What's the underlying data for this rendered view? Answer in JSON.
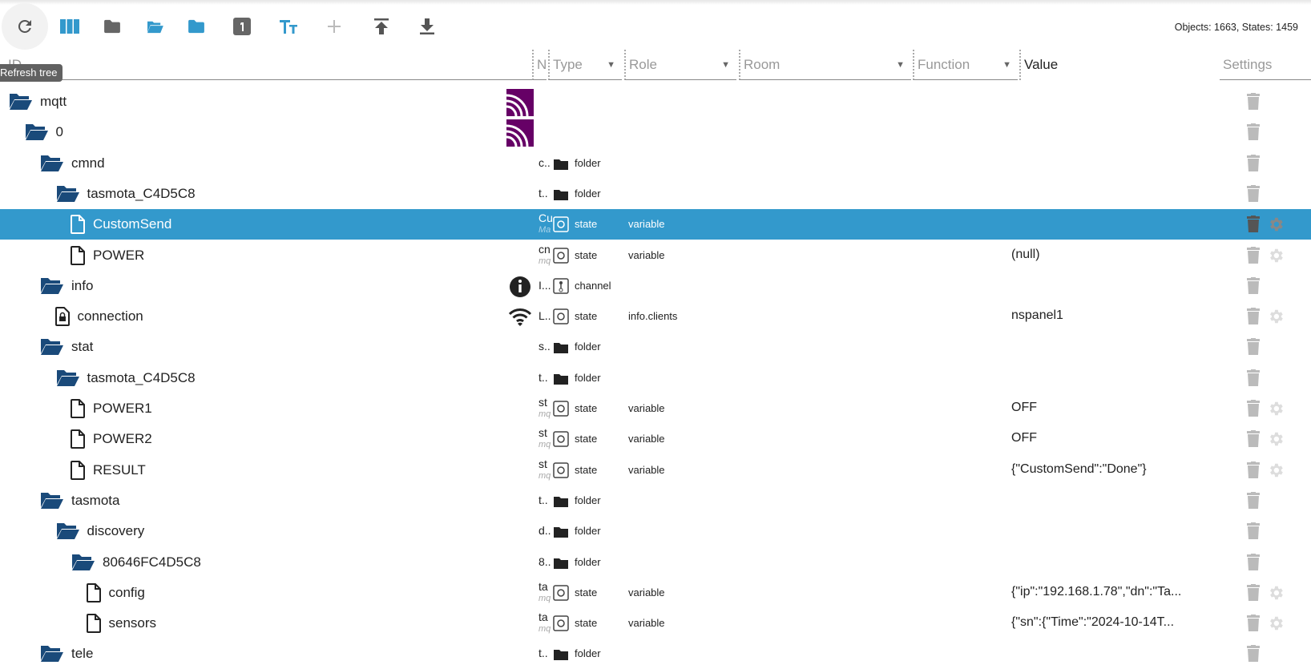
{
  "toolbar": {
    "refresh_tooltip": "Refresh tree",
    "buttons": [
      "refresh-icon",
      "columns-icon",
      "folder-icon",
      "folder-open-icon",
      "folder-blue-icon",
      "number-one-icon",
      "text-size-icon",
      "plus-icon",
      "upload-icon",
      "download-icon"
    ],
    "counts": "Objects: 1663, States: 1459"
  },
  "colors": {
    "accent": "#3399cc",
    "folder": "#1a4a7a",
    "toolbar_blue": "#3399cc",
    "toolbar_gray": "#666666",
    "mqtt_logo": "#660066"
  },
  "columns": {
    "id": "ID",
    "name": "N",
    "type": "Type",
    "role": "Role",
    "room": "Room",
    "function": "Function",
    "value": "Value",
    "settings": "Settings"
  },
  "rows": [
    {
      "level": 0,
      "icon": "folder-open",
      "name": "mqtt",
      "nameIcon": "mqtt-logo"
    },
    {
      "level": 1,
      "icon": "folder-open",
      "name": "0",
      "nameIcon": "mqtt-logo"
    },
    {
      "level": 2,
      "icon": "folder-open",
      "name": "cmnd",
      "ncol": "c..",
      "type": "folder"
    },
    {
      "level": 3,
      "icon": "folder-open",
      "name": "tasmota_C4D5C8",
      "ncol": "t..",
      "type": "folder"
    },
    {
      "level": 4,
      "icon": "file",
      "name": "CustomSend",
      "ncol": "Cu",
      "nsub": "Ma",
      "type": "state",
      "role": "variable",
      "gear": true,
      "selected": true
    },
    {
      "level": 4,
      "icon": "file",
      "name": "POWER",
      "ncol": "cn",
      "nsub": "mq",
      "type": "state",
      "role": "variable",
      "value": "(null)",
      "gear": true
    },
    {
      "level": 2,
      "icon": "folder-open",
      "name": "info",
      "nameIcon": "info",
      "ncol": "I...",
      "type": "channel"
    },
    {
      "level": 3,
      "icon": "file-lock",
      "name": "connection",
      "nameIcon": "wifi",
      "ncol": "L..",
      "type": "state",
      "role": "info.clients",
      "value": "nspanel1",
      "gear": true
    },
    {
      "level": 2,
      "icon": "folder-open",
      "name": "stat",
      "ncol": "s..",
      "type": "folder"
    },
    {
      "level": 3,
      "icon": "folder-open",
      "name": "tasmota_C4D5C8",
      "ncol": "t..",
      "type": "folder"
    },
    {
      "level": 4,
      "icon": "file",
      "name": "POWER1",
      "ncol": "st",
      "nsub": "mq",
      "type": "state",
      "role": "variable",
      "value": "OFF",
      "gear": true
    },
    {
      "level": 4,
      "icon": "file",
      "name": "POWER2",
      "ncol": "st",
      "nsub": "mq",
      "type": "state",
      "role": "variable",
      "value": "OFF",
      "gear": true
    },
    {
      "level": 4,
      "icon": "file",
      "name": "RESULT",
      "ncol": "st",
      "nsub": "mq",
      "type": "state",
      "role": "variable",
      "value": "{\"CustomSend\":\"Done\"}",
      "gear": true
    },
    {
      "level": 2,
      "icon": "folder-open",
      "name": "tasmota",
      "ncol": "t..",
      "type": "folder"
    },
    {
      "level": 3,
      "icon": "folder-open",
      "name": "discovery",
      "ncol": "d..",
      "type": "folder"
    },
    {
      "level": 4,
      "icon": "folder-open",
      "name": "80646FC4D5C8",
      "ncol": "8..",
      "type": "folder"
    },
    {
      "level": 5,
      "icon": "file",
      "name": "config",
      "ncol": "ta",
      "nsub": "mq",
      "type": "state",
      "role": "variable",
      "value": "{\"ip\":\"192.168.1.78\",\"dn\":\"Ta...",
      "gear": true
    },
    {
      "level": 5,
      "icon": "file",
      "name": "sensors",
      "ncol": "ta",
      "nsub": "mq",
      "type": "state",
      "role": "variable",
      "value": "{\"sn\":{\"Time\":\"2024-10-14T...",
      "gear": true
    },
    {
      "level": 2,
      "icon": "folder-open",
      "name": "tele",
      "ncol": "t..",
      "type": "folder"
    }
  ]
}
